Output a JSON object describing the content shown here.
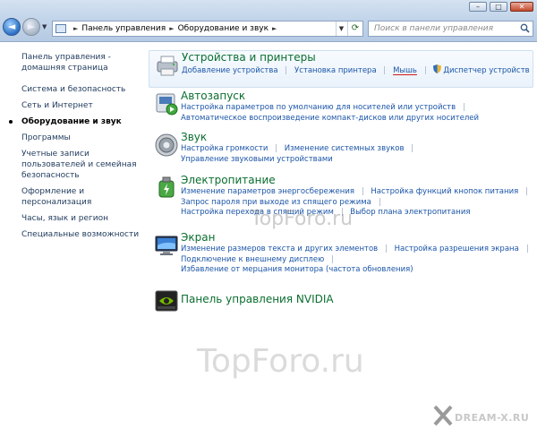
{
  "window_controls": {
    "minimize": "–",
    "maximize": "□",
    "close": "✕"
  },
  "nav": {
    "back": "◄",
    "forward": "►",
    "history": "▼"
  },
  "address": {
    "crumbs": [
      "Панель управления",
      "Оборудование и звук"
    ],
    "separator": "►",
    "dropdown": "▼",
    "refresh": "⟳"
  },
  "search": {
    "placeholder": "Поиск в панели управления"
  },
  "sidebar": {
    "home": "Панель управления - домашняя страница",
    "items": [
      "Система и безопасность",
      "Сеть и Интернет",
      "Оборудование и звук",
      "Программы",
      "Учетные записи пользователей и семейная безопасность",
      "Оформление и персонализация",
      "Часы, язык и регион",
      "Специальные возможности"
    ],
    "current_index": 2
  },
  "categories": {
    "devices": {
      "title": "Устройства и принтеры",
      "links": [
        "Добавление устройства",
        "Установка принтера",
        "Мышь",
        "Диспетчер устройств"
      ],
      "icon": "printer-icon"
    },
    "autoplay": {
      "title": "Автозапуск",
      "links": [
        "Настройка параметров по умолчанию для носителей или устройств",
        "Автоматическое воспроизведение компакт-дисков или других носителей"
      ],
      "icon": "autoplay-icon"
    },
    "sound": {
      "title": "Звук",
      "links": [
        "Настройка громкости",
        "Изменение системных звуков",
        "Управление звуковыми устройствами"
      ],
      "icon": "speaker-icon"
    },
    "power": {
      "title": "Электропитание",
      "links": [
        "Изменение параметров энергосбережения",
        "Настройка функций кнопок питания",
        "Запрос пароля при выходе из спящего режима",
        "Настройка перехода в спящий режим",
        "Выбор плана электропитания"
      ],
      "icon": "power-icon"
    },
    "display": {
      "title": "Экран",
      "links": [
        "Изменение размеров текста и других элементов",
        "Настройка разрешения экрана",
        "Подключение к внешнему дисплею",
        "Избавление от мерцания монитора (частота обновления)"
      ],
      "icon": "monitor-icon"
    },
    "nvidia": {
      "title": "Панель управления NVIDIA",
      "icon": "nvidia-icon"
    }
  },
  "watermarks": {
    "topforo": "TopForo.ru",
    "topforo_mid": "TopForo.ru",
    "dream": "DREAM-X.RU"
  },
  "colors": {
    "link": "#1b55a8",
    "category_title": "#0a6e2f",
    "highlight_underline": "#d21a1a"
  }
}
